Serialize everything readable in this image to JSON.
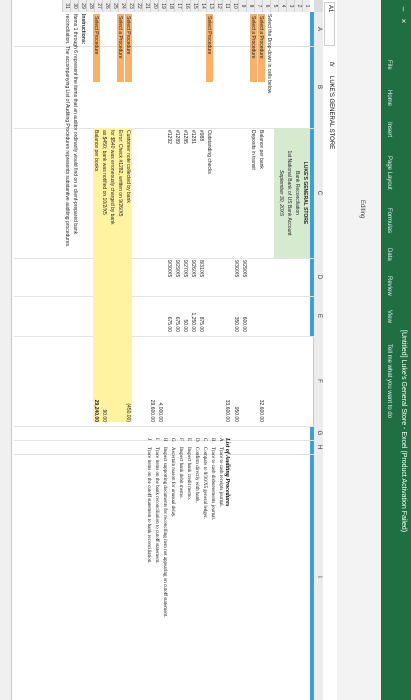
{
  "window": {
    "title": "[Untitled] Luke's General Store - Excel (Product Activation Failed)",
    "minimize": "–",
    "close": "×"
  },
  "ribbon_tabs": [
    "File",
    "Home",
    "Insert",
    "Page Layout",
    "Formulas",
    "Data",
    "Review",
    "View",
    "Tell me what you want to do"
  ],
  "toolbar_hint": "Editing",
  "formula_bar": {
    "name_box": "A1",
    "fx": "fx",
    "content": "LUKE'S GENERAL STORE"
  },
  "columns": [
    "A",
    "B",
    "C",
    "D",
    "E",
    "F",
    "G",
    "H",
    "I"
  ],
  "rows": [
    "1",
    "2",
    "3",
    "4",
    "5",
    "6",
    "7",
    "8",
    "9",
    "10",
    "11",
    "12",
    "13",
    "14",
    "15",
    "16",
    "17",
    "18",
    "19",
    "20",
    "21",
    "22",
    "23",
    "24",
    "25",
    "26",
    "27",
    "28",
    "29",
    "30",
    "31"
  ],
  "sheet": {
    "header_lines": [
      "LUKE'S GENERAL STORE",
      "Bank Reconciliation",
      "1st National Bank of US Bank Account",
      "September 30, 20X5"
    ],
    "instruction_top": "Select the Drop-down in cells below",
    "left_labels": [
      "Select a Procedure",
      "Select a Procedure"
    ],
    "items": [
      {
        "label": "Balance per bank",
        "date": "",
        "amount": "",
        "total": "32,600.00"
      },
      {
        "label": "Deposits in transit",
        "date": "",
        "amount": "",
        "total": ""
      },
      {
        "label": "",
        "date": "9/29/X5",
        "amount": "600.00",
        "total": ""
      },
      {
        "label": "",
        "date": "9/30/X5",
        "amount": "350.00",
        "total": "950.00"
      },
      {
        "label": "",
        "date": "",
        "amount": "",
        "total": "33,600.00"
      }
    ],
    "outstanding": {
      "proc": "Select Procedure",
      "label": "Outstanding checks",
      "checks": [
        {
          "no": "#988",
          "date": "8/31/X5",
          "amount": "875.00"
        },
        {
          "no": "#1281",
          "date": "9/26/X5",
          "amount": "1,250.00"
        },
        {
          "no": "#1285",
          "date": "9/27/X5",
          "amount": "50.00"
        },
        {
          "no": "#1289",
          "date": "9/29/X5",
          "amount": "675.00"
        },
        {
          "no": "#1292",
          "date": "9/30/X5",
          "amount": "675.00"
        }
      ],
      "total": "4,000.00",
      "balance": "29,600.00"
    },
    "lower": [
      {
        "proc": "Select Procedure",
        "label": "Customer note collected by bank",
        "amount": "(450.00)"
      },
      {
        "proc": "Select a Procedure",
        "label": "Error: Check #1282, written on 9/26/X5",
        "amount": ""
      },
      {
        "proc": "",
        "label": "for $540 was erroneously charged by bank",
        "amount": ""
      },
      {
        "proc": "",
        "label": "as $450; bank was notified on 10/2/X5",
        "amount": "90.00"
      },
      {
        "proc": "Select Procedure",
        "label": "Balance per books",
        "amount": "29,240.00"
      }
    ],
    "instructions_head": "Instructions:",
    "instructions": [
      "Items 1 through 6 represent the items that an auditor ordinarily would find on a client-prepared bank",
      "reconciliation. The accompanying List of Auditing Procedures represents substantive auditing procedures."
    ]
  },
  "legend": {
    "title": "List of Auditing Procedures",
    "items": [
      {
        "letter": "A",
        "text": "Trace to cash receipts journal."
      },
      {
        "letter": "B",
        "text": "Trace to cash disbursements journal."
      },
      {
        "letter": "C",
        "text": "Compare to 9/30/X5 general ledger."
      },
      {
        "letter": "D",
        "text": "Confirm directly with bank."
      },
      {
        "letter": "E",
        "text": "Inspect bank credit memo."
      },
      {
        "letter": "F",
        "text": "Inspect bank debit memo."
      },
      {
        "letter": "G",
        "text": "Ascertain reason for unusual delay."
      },
      {
        "letter": "H",
        "text": "Inspect supporting documents for reconciling item not appearing on cutoff statement."
      },
      {
        "letter": "I",
        "text": "Trace items on the bank reconciliation to cutoff statement."
      },
      {
        "letter": "J",
        "text": "Trace items on the cutoff statement to bank reconciliation."
      }
    ]
  },
  "colors": {
    "excel_green": "#1f6f43",
    "stripe": "#3aa0d8",
    "proc_cell": "#f6b26b",
    "amount_cell": "#fff2a0"
  }
}
